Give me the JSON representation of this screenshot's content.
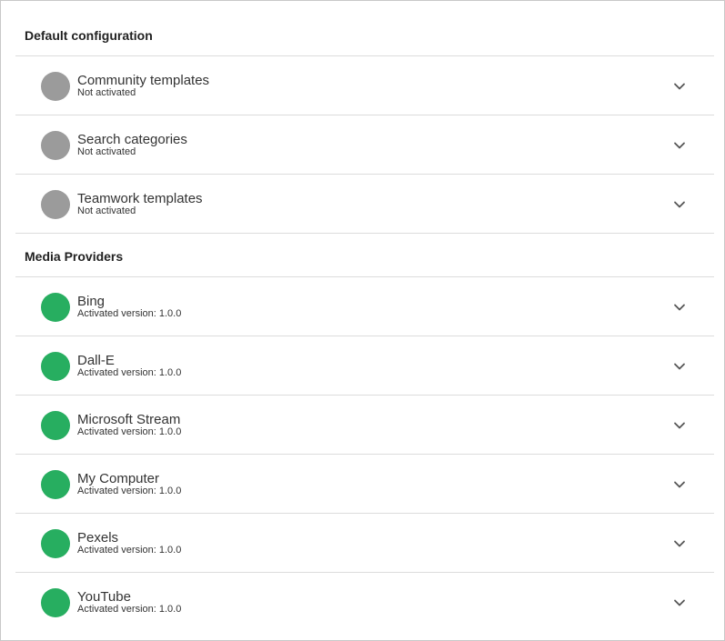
{
  "colors": {
    "inactive": "#9b9b9b",
    "active": "#27ae60"
  },
  "default_configuration": {
    "title": "Default configuration",
    "items": [
      {
        "name": "Community templates",
        "status": "Not activated",
        "active": false
      },
      {
        "name": "Search categories",
        "status": "Not activated",
        "active": false
      },
      {
        "name": "Teamwork templates",
        "status": "Not activated",
        "active": false
      }
    ]
  },
  "media_providers": {
    "title": "Media Providers",
    "items": [
      {
        "name": "Bing",
        "status": "Activated version: 1.0.0",
        "active": true
      },
      {
        "name": "Dall-E",
        "status": "Activated version: 1.0.0",
        "active": true
      },
      {
        "name": "Microsoft Stream",
        "status": "Activated version: 1.0.0",
        "active": true
      },
      {
        "name": "My Computer",
        "status": "Activated version: 1.0.0",
        "active": true
      },
      {
        "name": "Pexels",
        "status": "Activated version: 1.0.0",
        "active": true
      },
      {
        "name": "YouTube",
        "status": "Activated version: 1.0.0",
        "active": true
      }
    ]
  },
  "icons": {
    "status": "status-dot-icon",
    "expand": "chevron-down-icon"
  }
}
